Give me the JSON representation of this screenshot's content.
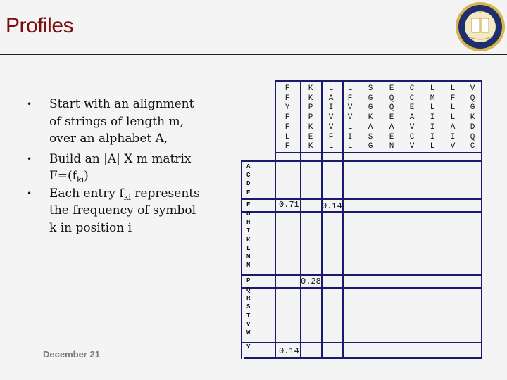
{
  "slide": {
    "title": "Profiles",
    "logo": "uc-san-diego-seal",
    "footer": "December 21",
    "bullets": [
      {
        "text": "Start with an alignment of strings of length m, over an alphabet A,"
      },
      {
        "text_before": "Build an |A| X m matrix F=(f",
        "sub": "ki",
        "text_after": ")"
      },
      {
        "text_before": "Each entry f",
        "sub": "ki",
        "text_after": " represents the frequency of symbol k in position i"
      }
    ],
    "bullet_glyph": "•"
  },
  "matrix": {
    "alignment_columns": [
      [
        "F",
        "F",
        "Y",
        "F",
        "F",
        "L",
        "F"
      ],
      [
        "K",
        "K",
        "P",
        "P",
        "K",
        "E",
        "K"
      ],
      [
        "L",
        "A",
        "I",
        "V",
        "V",
        "F",
        "L"
      ],
      [
        "L",
        "F",
        "V",
        "V",
        "L",
        "I",
        "L"
      ],
      [
        "S",
        "G",
        "G",
        "K",
        "A",
        "S",
        "G"
      ],
      [
        "E",
        "Q",
        "Q",
        "E",
        "A",
        "E",
        "N"
      ],
      [
        "C",
        "C",
        "E",
        "A",
        "V",
        "C",
        "V"
      ],
      [
        "L",
        "M",
        "L",
        "I",
        "I",
        "I",
        "L"
      ],
      [
        "L",
        "F",
        "L",
        "L",
        "A",
        "I",
        "V"
      ],
      [
        "V",
        "Q",
        "G",
        "K",
        "D",
        "Q",
        "C"
      ]
    ],
    "row_labels": [
      "A",
      "C",
      "D",
      "E",
      "F",
      "G",
      "H",
      "I",
      "K",
      "L",
      "M",
      "N",
      "P",
      "Q",
      "R",
      "S",
      "T",
      "V",
      "W",
      "Y"
    ],
    "values": [
      {
        "symbol": "F",
        "column": 1,
        "value": "0.71"
      },
      {
        "symbol": "F",
        "column": 3,
        "value": "0.14"
      },
      {
        "symbol": "P",
        "column": 2,
        "value": "0.28"
      },
      {
        "symbol": "Y",
        "column": 1,
        "value": "0.14"
      }
    ]
  }
}
